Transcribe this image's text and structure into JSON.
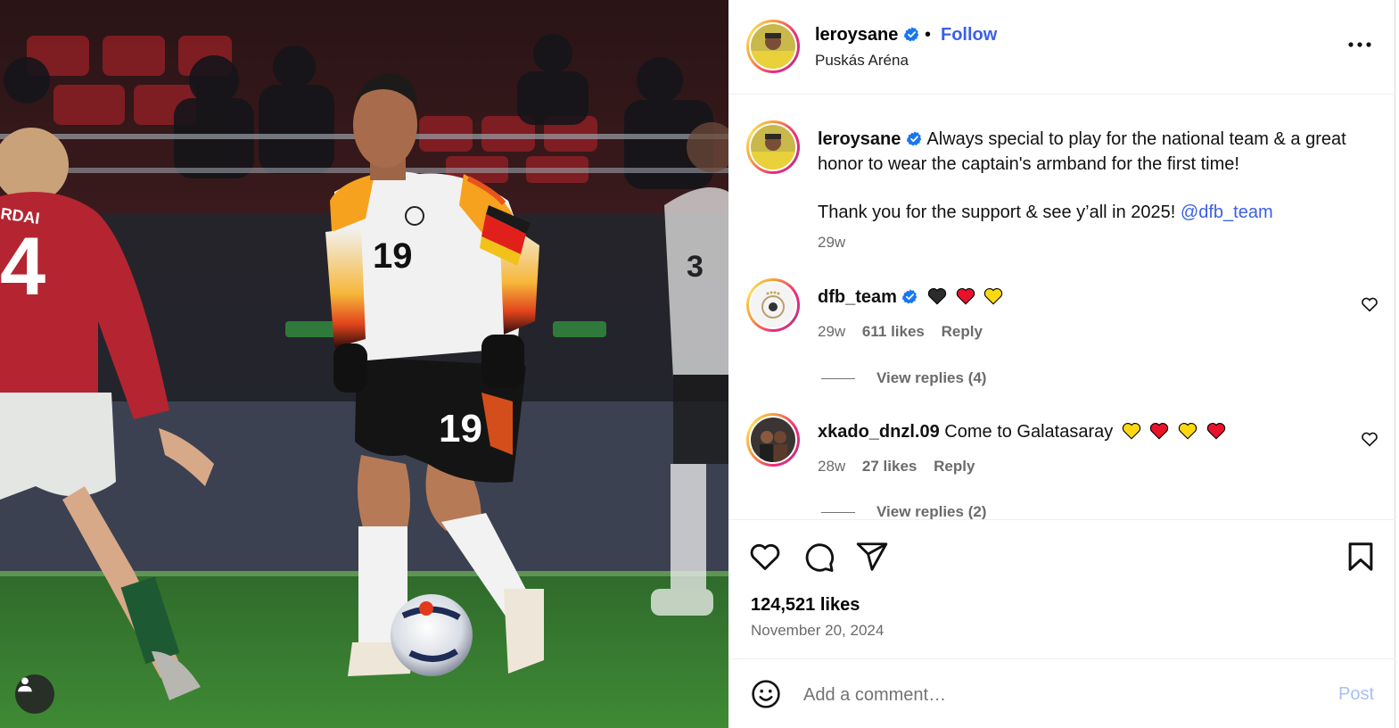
{
  "header": {
    "username": "leroysane",
    "separator": "•",
    "follow_label": "Follow",
    "location": "Puskás Aréna"
  },
  "caption": {
    "username": "leroysane",
    "line1": "Always special to play for the national team & a great honor to wear the captain's armband for the first time!",
    "line2_text": "Thank you for the support & see y’all in 2025!",
    "line2_mention": "@dfb_team",
    "time": "29w"
  },
  "comments": [
    {
      "username": "dfb_team",
      "verified": true,
      "text": "",
      "emojis": [
        "black-heart",
        "red-heart",
        "yellow-heart"
      ],
      "time": "29w",
      "likes": "611 likes",
      "reply_label": "Reply",
      "view_replies": "View replies (4)"
    },
    {
      "username": "xkado_dnzl.09",
      "verified": false,
      "text": "Come to Galatasaray",
      "emojis": [
        "yellow-heart",
        "red-heart",
        "yellow-heart",
        "red-heart"
      ],
      "time": "28w",
      "likes": "27 likes",
      "reply_label": "Reply",
      "view_replies": "View replies (2)"
    }
  ],
  "post": {
    "likes": "124,521 likes",
    "date": "November 20, 2024"
  },
  "add_comment": {
    "placeholder": "Add a comment…",
    "post_label": "Post"
  },
  "colors": {
    "link_blue": "#3b5fe8",
    "muted_text": "#6b6b6b",
    "post_disabled": "#a7c1f2",
    "verified_blue": "#1877f2"
  },
  "photo_overlay": {
    "shirt_number": "19",
    "opponent_name_fragment": "RDAI",
    "opponent_number": "4",
    "teammate_number": "3"
  },
  "icons": [
    "verified-badge-icon",
    "more-options-icon",
    "heart-icon",
    "comment-icon",
    "share-icon",
    "save-icon",
    "emoji-icon",
    "user-tag-icon"
  ]
}
